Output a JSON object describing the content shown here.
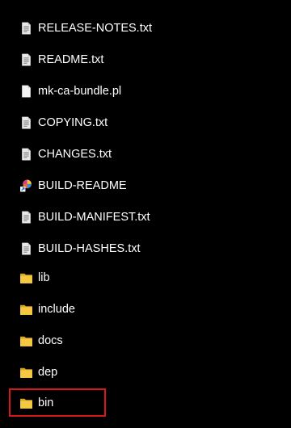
{
  "files": [
    {
      "name": "RELEASE-NOTES.txt",
      "icon": "text-file-icon",
      "type": "file"
    },
    {
      "name": "README.txt",
      "icon": "text-file-icon",
      "type": "file"
    },
    {
      "name": "mk-ca-bundle.pl",
      "icon": "blank-file-icon",
      "type": "file"
    },
    {
      "name": "COPYING.txt",
      "icon": "text-file-icon",
      "type": "file"
    },
    {
      "name": "CHANGES.txt",
      "icon": "text-file-icon",
      "type": "file"
    },
    {
      "name": "BUILD-README",
      "icon": "shortcut-app-icon",
      "type": "file"
    },
    {
      "name": "BUILD-MANIFEST.txt",
      "icon": "text-file-icon",
      "type": "file"
    },
    {
      "name": "BUILD-HASHES.txt",
      "icon": "text-file-icon",
      "type": "file"
    },
    {
      "name": "lib",
      "icon": "folder-icon",
      "type": "folder"
    },
    {
      "name": "include",
      "icon": "folder-icon",
      "type": "folder"
    },
    {
      "name": "docs",
      "icon": "folder-icon",
      "type": "folder"
    },
    {
      "name": "dep",
      "icon": "folder-icon",
      "type": "folder"
    },
    {
      "name": "bin",
      "icon": "folder-icon",
      "type": "folder",
      "highlighted": true
    }
  ],
  "colors": {
    "background": "#000000",
    "text": "#ffffff",
    "highlight": "#d9171e",
    "folder": "#f5c842"
  }
}
